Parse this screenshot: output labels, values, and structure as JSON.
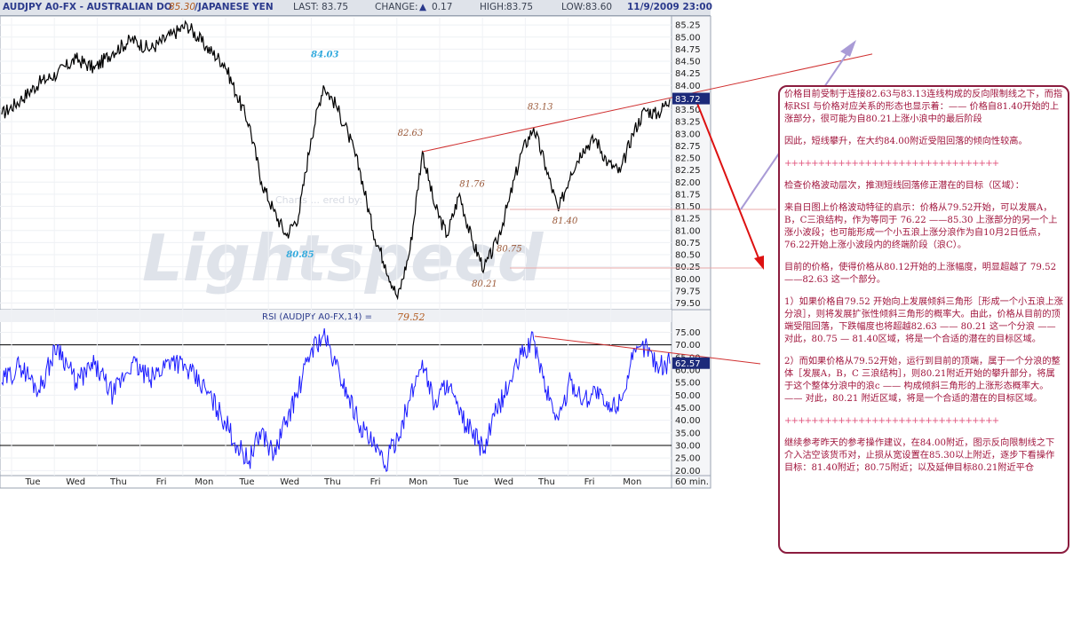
{
  "header": {
    "symbol": "AUDJPY A0-FX - AUSTRALIAN DO",
    "overlay_price": "85.30",
    "symbol_tail": "/JAPANESE YEN",
    "last_label": "LAST:",
    "last_value": "83.75",
    "change_label": "CHANGE:",
    "change_value": "0.17",
    "high_label": "HIGH:",
    "high_value": "83.75",
    "low_label": "LOW:",
    "low_value": "83.60",
    "datetime": "11/9/2009 23:00"
  },
  "watermark": {
    "small": "Charts ... ered by:",
    "big": "Lightspeed"
  },
  "colors": {
    "price": "#000000",
    "rsi": "#1a1aff",
    "trendline": "#d03030",
    "arrow": "#a99bd6",
    "annotation": "#9b5a3a",
    "highlight": "#33aadd",
    "note": "#a0143c"
  },
  "chart_data": [
    {
      "type": "line",
      "name": "AUDJPY A0-FX 60 min",
      "timeframe": "60 min.",
      "x_labels": [
        "Tue",
        "Wed",
        "Thu",
        "Fri",
        "Mon",
        "Tue",
        "Wed",
        "Thu",
        "Fri",
        "Mon",
        "Tue",
        "Wed",
        "Thu",
        "Fri",
        "Mon"
      ],
      "y_ticks": [
        "85.25",
        "85.00",
        "84.75",
        "84.50",
        "84.25",
        "84.00",
        "83.75",
        "83.50",
        "83.25",
        "83.00",
        "82.75",
        "82.50",
        "82.25",
        "82.00",
        "81.75",
        "81.50",
        "81.25",
        "81.00",
        "80.75",
        "80.50",
        "80.25",
        "80.00",
        "79.75",
        "79.50"
      ],
      "ylim": [
        79.4,
        85.4
      ],
      "last_value_tag": "83.72",
      "anchors": [
        [
          0,
          83.4
        ],
        [
          6,
          83.7
        ],
        [
          12,
          84.05
        ],
        [
          18,
          84.25
        ],
        [
          24,
          84.55
        ],
        [
          30,
          84.35
        ],
        [
          36,
          84.7
        ],
        [
          42,
          84.95
        ],
        [
          48,
          84.75
        ],
        [
          55,
          85.05
        ],
        [
          60,
          85.25
        ],
        [
          66,
          84.8
        ],
        [
          72,
          84.45
        ],
        [
          76,
          83.8
        ],
        [
          80,
          83.2
        ],
        [
          84,
          82.0
        ],
        [
          88,
          81.4
        ],
        [
          92,
          80.9
        ],
        [
          96,
          81.3
        ],
        [
          100,
          82.9
        ],
        [
          104,
          84.0
        ],
        [
          108,
          83.6
        ],
        [
          112,
          83.0
        ],
        [
          116,
          82.2
        ],
        [
          120,
          81.0
        ],
        [
          124,
          80.3
        ],
        [
          128,
          79.6
        ],
        [
          132,
          80.6
        ],
        [
          136,
          82.63
        ],
        [
          140,
          81.5
        ],
        [
          144,
          80.9
        ],
        [
          148,
          81.76
        ],
        [
          152,
          80.8
        ],
        [
          156,
          80.21
        ],
        [
          160,
          80.75
        ],
        [
          164,
          81.6
        ],
        [
          168,
          82.6
        ],
        [
          172,
          83.13
        ],
        [
          176,
          82.3
        ],
        [
          180,
          81.4
        ],
        [
          184,
          82.2
        ],
        [
          188,
          82.7
        ],
        [
          192,
          82.9
        ],
        [
          196,
          82.4
        ],
        [
          200,
          82.2
        ],
        [
          204,
          83.0
        ],
        [
          208,
          83.5
        ],
        [
          212,
          83.4
        ],
        [
          216,
          83.72
        ]
      ],
      "annotations": [
        "84.03",
        "80.85",
        "82.63",
        "81.76",
        "80.21",
        "80.75",
        "83.13",
        "81.40"
      ],
      "trendline": {
        "from": [
          136,
          82.63
        ],
        "through": [
          172,
          83.13
        ]
      }
    },
    {
      "type": "line",
      "name": "RSI (AUDJPY A0-FX,14)",
      "label": "RSI (AUDJPY A0-FX,14) =",
      "label_value": "79.52",
      "y_ticks": [
        "75.00",
        "70.00",
        "65.00",
        "60.00",
        "55.00",
        "50.00",
        "45.00",
        "40.00",
        "35.00",
        "30.00",
        "25.00",
        "20.00"
      ],
      "ylim": [
        18,
        78
      ],
      "levels": [
        70,
        30
      ],
      "last_value_tag": "62.57",
      "anchors": [
        [
          0,
          55
        ],
        [
          6,
          62
        ],
        [
          12,
          52
        ],
        [
          18,
          70
        ],
        [
          24,
          55
        ],
        [
          30,
          62
        ],
        [
          36,
          50
        ],
        [
          42,
          63
        ],
        [
          48,
          56
        ],
        [
          55,
          65
        ],
        [
          60,
          60
        ],
        [
          66,
          52
        ],
        [
          72,
          40
        ],
        [
          76,
          30
        ],
        [
          80,
          24
        ],
        [
          84,
          36
        ],
        [
          88,
          26
        ],
        [
          92,
          40
        ],
        [
          96,
          52
        ],
        [
          100,
          68
        ],
        [
          104,
          74
        ],
        [
          108,
          62
        ],
        [
          112,
          50
        ],
        [
          116,
          38
        ],
        [
          120,
          30
        ],
        [
          124,
          22
        ],
        [
          128,
          34
        ],
        [
          132,
          48
        ],
        [
          136,
          64
        ],
        [
          140,
          46
        ],
        [
          144,
          56
        ],
        [
          148,
          42
        ],
        [
          152,
          35
        ],
        [
          156,
          28
        ],
        [
          160,
          44
        ],
        [
          164,
          54
        ],
        [
          168,
          66
        ],
        [
          172,
          72
        ],
        [
          176,
          52
        ],
        [
          180,
          40
        ],
        [
          184,
          56
        ],
        [
          188,
          48
        ],
        [
          192,
          52
        ],
        [
          196,
          44
        ],
        [
          200,
          48
        ],
        [
          204,
          64
        ],
        [
          208,
          70
        ],
        [
          212,
          62
        ],
        [
          216,
          62.57
        ]
      ]
    }
  ],
  "note": {
    "p1": "价格目前受制于连接82.63与83.13连线构成的反向限制线之下，而指标RSI 与价格对应关系的形态也显示着：—— 价格自81.40开始的上涨部分，很可能为自80.21上涨小浪中的最后阶段",
    "p2": "因此，短线攀升，在大约84.00附近受阻回落的倾向性较高。",
    "sep": "++++++++++++++++++++++++++++++++",
    "p3": "检查价格波动层次，推测短线回落修正潜在的目标（区域）：",
    "p4": "来自日图上价格波动特征的启示：价格从79.52开始，可以发展A，B，C三浪结构，作为等同于 76.22 ——85.30 上涨部分的另一个上涨小波段；也可能形成一个小五浪上涨分浪作为自10月2日低点，76.22开始上涨小波段内的终端阶段（浪C）。",
    "p5": "目前的价格，使得价格从80.12开始的上涨幅度，明显超越了 79.52 ——82.63 这一个部分。",
    "p6": "1）如果价格自79.52 开始向上发展倾斜三角形［形成一个小五浪上涨分浪］，则将发展扩张性倾斜三角形的概率大。由此，价格从目前的顶端受阻回落，下跌幅度也将超越82.63 —— 80.21 这一个分浪 —— 对此，80.75 — 81.40区域，将是一个合适的潜在的目标区域。",
    "p7": "2）而如果价格从79.52开始，运行到目前的顶端，属于一个分浪的整体［发展A，B，C 三浪结构］，则80.21附近开始的攀升部分，将属于这个整体分浪中的浪c —— 构成倾斜三角形的上涨形态概率大。 —— 对此，80.21 附近区域，将是一个合适的潜在的目标区域。",
    "sep2": "++++++++++++++++++++++++++++++++",
    "p8": "继续参考昨天的参考操作建议，在84.00附近，图示反向限制线之下介入沽空该货币对，止损从宽设置在85.30以上附近，逐步下看操作目标：81.40附近；80.75附近；以及延伸目标80.21附近平仓"
  }
}
